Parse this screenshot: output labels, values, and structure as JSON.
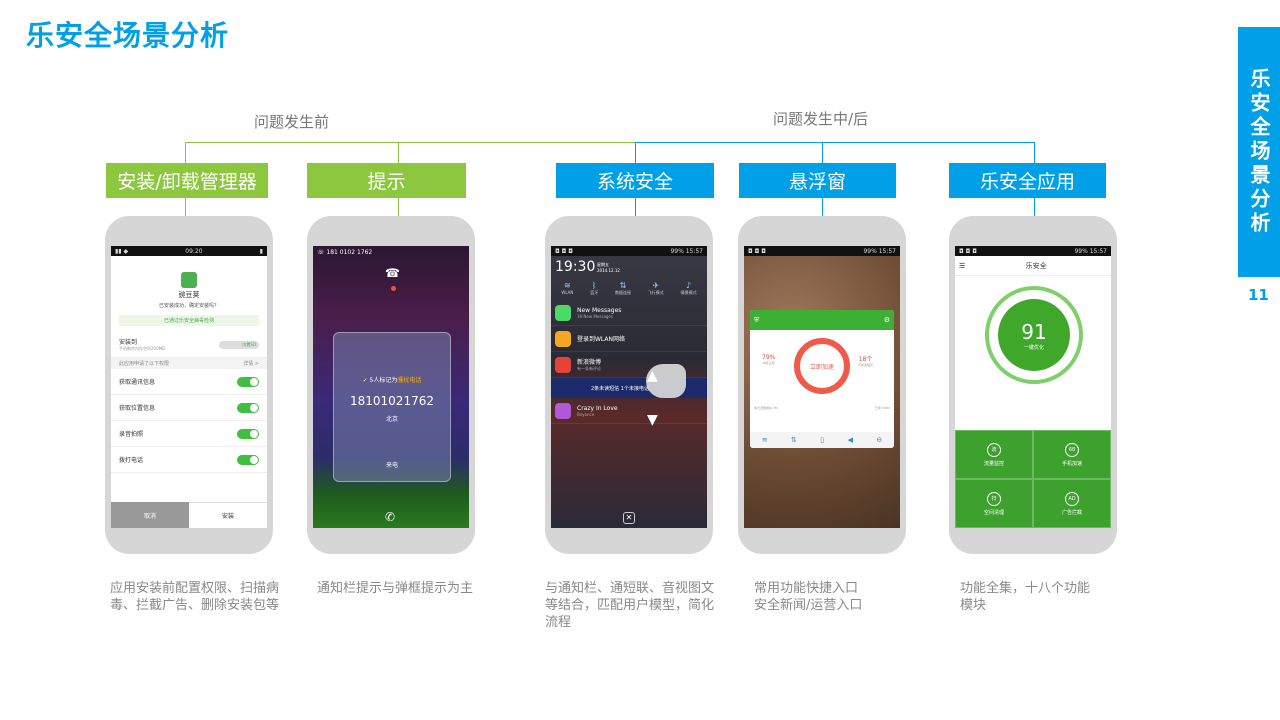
{
  "header": {
    "title": "乐安全场景分析"
  },
  "side_tab": {
    "label": "乐安全场景分析",
    "page_number": "11"
  },
  "phases": {
    "before": "问题发生前",
    "during_after": "问题发生中/后"
  },
  "categories": [
    {
      "label": "安装/卸载管理器",
      "desc_lines": [
        "应用安装前配置权限、扫描病",
        "毒、拦截广告、删除安装包等"
      ]
    },
    {
      "label": "提示",
      "desc_lines": [
        "通知栏提示与弹框提示为主"
      ]
    },
    {
      "label": "系统安全",
      "desc_lines": [
        "与通知栏、通短联、音视图文",
        "等结合，匹配用户模型，简化",
        "流程"
      ]
    },
    {
      "label": "悬浮窗",
      "desc_lines": [
        "常用功能快捷入口",
        "安全新闻/运营入口"
      ]
    },
    {
      "label": "乐安全应用",
      "desc_lines": [
        "功能全集，十八个功能",
        "模块"
      ]
    }
  ],
  "colors": {
    "accent_blue": "#00a0e9",
    "accent_green": "#8dc63f"
  },
  "phone1": {
    "status_time": "09:20",
    "app_name": "豌豆荚",
    "ask": "已安装成功，确定安装吗？",
    "safe_notice": "已通过乐安全病毒检测",
    "install_to": "安装到",
    "install_to_sub": "手机剩余内存空间200MB",
    "storage_pill": "内置SD",
    "permission_hint": "此应用申请了以下权限",
    "details": "详情 >",
    "permissions": [
      "获取通讯信息",
      "获取位置信息",
      "录音拍照",
      "拨打电话"
    ],
    "cancel": "取消",
    "install": "安装"
  },
  "phone2": {
    "number_top": "181 0102 1762",
    "marked_prefix": "5人标记为",
    "marked_tag": "骚扰电话",
    "caller": "18101021762",
    "city": "北京",
    "incoming": "来电"
  },
  "phone3": {
    "status": "99% 15:57",
    "time": "19:30",
    "date_line1": "星期五",
    "date_line2": "2014.12.12",
    "quick_settings": [
      "WLAN",
      "蓝牙",
      "数据连接",
      "飞行模式",
      "情景模式"
    ],
    "notifications": [
      {
        "title": "New Messages",
        "sub": "19 New Messages"
      },
      {
        "title": "登录到WLAN网络",
        "sub": ""
      },
      {
        "title": "新浪微博",
        "sub": "有一条新评论"
      },
      {
        "title": "Crazy In Love",
        "sub": "Beyonce"
      }
    ],
    "popup": "2条未读短信  1个未接电话"
  },
  "phone4": {
    "status": "99% 15:57",
    "left_pct": "79%",
    "left_label": "内存占用",
    "center": "立即加速",
    "right_pct": "18个",
    "right_label": "可加速程序",
    "stat_left": "本日流量剩余  3M",
    "stat_right": "已用  300M"
  },
  "phone5": {
    "status": "99% 15:57",
    "title": "乐安全",
    "score": "91",
    "score_label": "一键优化",
    "tiles": [
      {
        "label": "流量监控",
        "icon": "流"
      },
      {
        "label": "手机加速",
        "icon": "68"
      },
      {
        "label": "空间清理",
        "icon": "扫"
      },
      {
        "label": "广告拦截",
        "icon": "AD"
      }
    ]
  }
}
